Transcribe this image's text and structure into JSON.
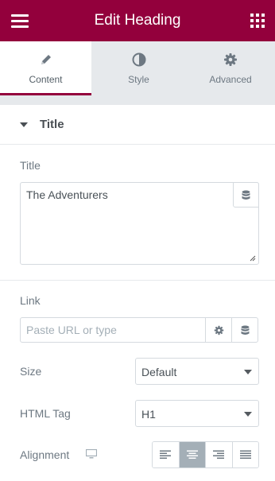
{
  "header": {
    "title": "Edit Heading",
    "menu_icon": "hamburger-icon",
    "widgets_icon": "grid-icon"
  },
  "tabs": [
    {
      "label": "Content",
      "icon": "pencil-icon",
      "active": true
    },
    {
      "label": "Style",
      "icon": "half-circle-icon",
      "active": false
    },
    {
      "label": "Advanced",
      "icon": "gear-icon",
      "active": false
    }
  ],
  "section": {
    "title": "Title",
    "icon": "caret-down-icon"
  },
  "title_field": {
    "label": "Title",
    "value": "The Adventurers"
  },
  "link_field": {
    "label": "Link",
    "placeholder": "Paste URL or type"
  },
  "size_field": {
    "label": "Size",
    "value": "Default"
  },
  "html_tag_field": {
    "label": "HTML Tag",
    "value": "H1"
  },
  "alignment_field": {
    "label": "Alignment",
    "options": [
      "left",
      "center",
      "right",
      "justify"
    ],
    "selected": "center"
  },
  "colors": {
    "brand": "#93003c",
    "panel_bg": "#e6e9ec",
    "selected_align": "#a4afb7"
  }
}
